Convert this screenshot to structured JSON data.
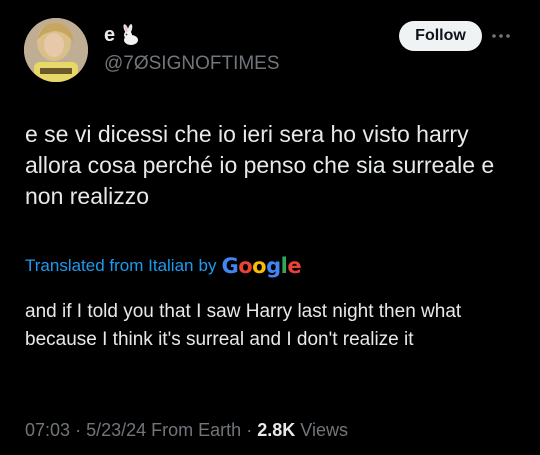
{
  "author": {
    "display_name": "e",
    "name_emoji_icon": "rabbit-icon",
    "handle": "@7ØSIGNOFTIMES"
  },
  "actions": {
    "follow_label": "Follow",
    "more_icon": "more-horizontal-icon"
  },
  "tweet": {
    "text": "e se vi dicessi che io ieri sera ho visto harry allora cosa perché io penso che sia surreale e non realizzo"
  },
  "translation": {
    "label": "Translated from Italian",
    "by": "by",
    "provider": "Google",
    "text": "and if I told you that I saw Harry last night then what because I think it's surreal and I don't realize it"
  },
  "meta": {
    "time": "07:03",
    "separator": "·",
    "date": "5/23/24",
    "source": "From Earth",
    "views_count": "2.8K",
    "views_label": "Views"
  },
  "colors": {
    "background": "#000000",
    "primary_text": "#e7e9ea",
    "secondary_text": "#71767b",
    "link": "#1d9bf0",
    "follow_bg": "#eff3f4",
    "google_blue": "#4285f4",
    "google_red": "#ea4335",
    "google_yellow": "#fbbc05",
    "google_green": "#34a853"
  }
}
